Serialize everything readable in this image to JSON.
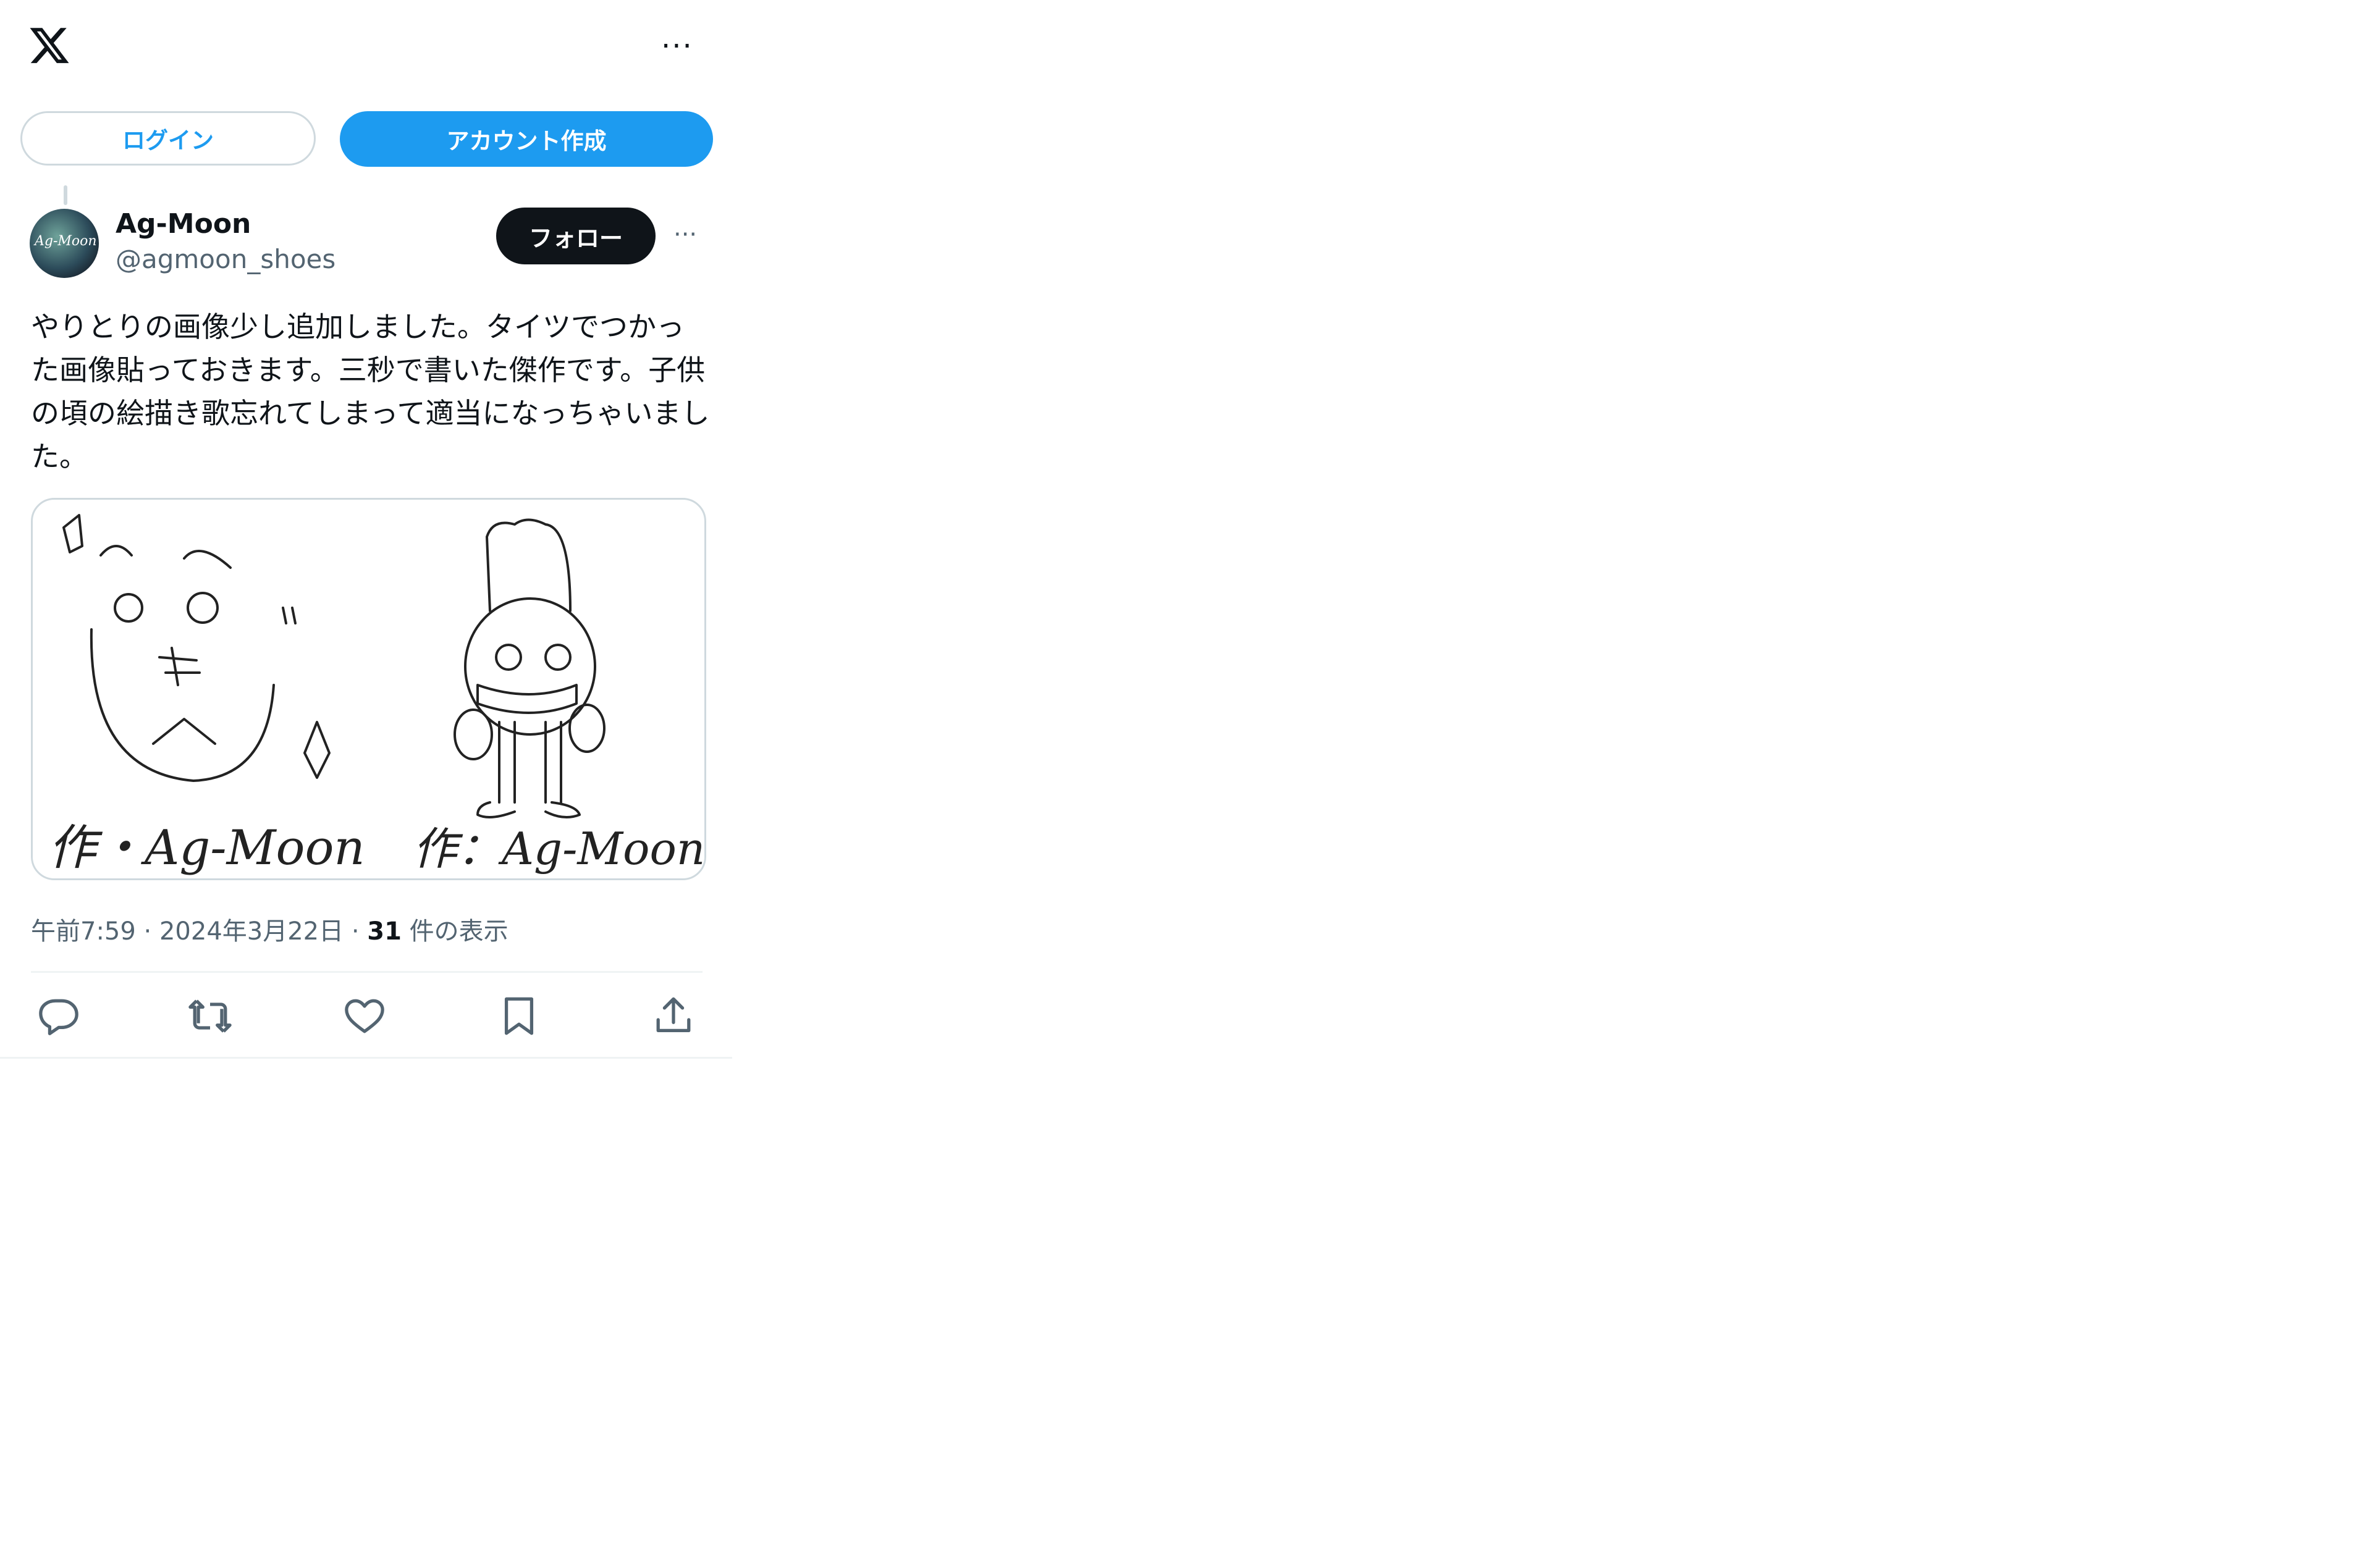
{
  "header": {
    "logo_icon": "x-logo-icon",
    "more_icon": "more-horizontal-icon",
    "more_glyph": "···"
  },
  "auth": {
    "login_label": "ログイン",
    "signup_label": "アカウント作成"
  },
  "post": {
    "author": {
      "display_name": "Ag-Moon",
      "handle": "@agmoon_shoes",
      "avatar_text": "Ag-Moon"
    },
    "follow_label": "フォロー",
    "more_glyph": "···",
    "text": "やりとりの画像少し追加しました。タイツでつかった画像貼っておきます。三秒で書いた傑作です。子供の頃の絵描き歌忘れてしまって適当になっちゃいました。",
    "media": {
      "description_left_sign": "作・Ag-Moon",
      "description_right_sign": "作：Ag-Moon"
    },
    "meta": {
      "time": "午前7:59",
      "sep1": " · ",
      "date": "2024年3月22日",
      "sep2": " · ",
      "views_count": "31",
      "views_label": " 件の表示"
    },
    "actions": {
      "reply_icon": "reply-icon",
      "repost_icon": "repost-icon",
      "like_icon": "like-icon",
      "bookmark_icon": "bookmark-icon",
      "share_icon": "share-icon"
    }
  },
  "colors": {
    "accent": "#1d9bf0",
    "text": "#0f1419",
    "muted": "#536471",
    "border": "#cfd9de"
  }
}
